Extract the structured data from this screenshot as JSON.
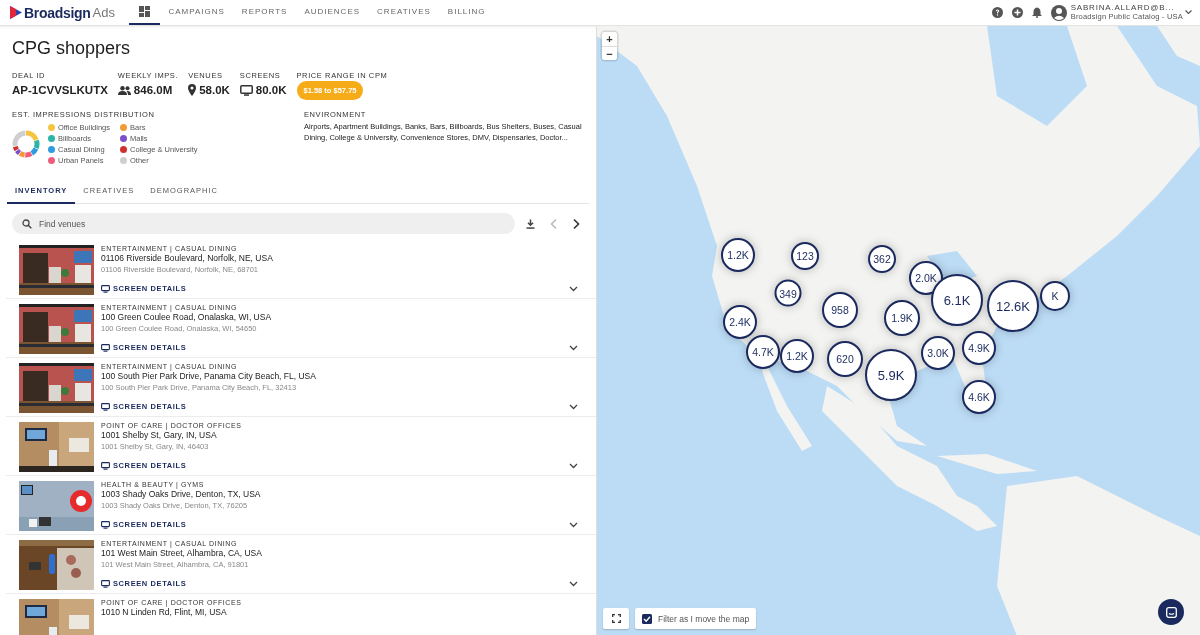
{
  "header": {
    "logo": {
      "brand": "Broadsign",
      "product": "Ads"
    },
    "nav": [
      {
        "kind": "icon",
        "selected": true
      },
      {
        "label": "CAMPAIGNS",
        "selected": false
      },
      {
        "label": "REPORTS",
        "selected": false
      },
      {
        "label": "AUDIENCES",
        "selected": false
      },
      {
        "label": "CREATIVES",
        "selected": false
      },
      {
        "label": "BILLING",
        "selected": false
      }
    ],
    "user": {
      "name": "SABRINA.ALLARD@B...",
      "account": "Broadsign Public Catalog - USA"
    }
  },
  "deal": {
    "title": "CPG shoppers",
    "stats": [
      {
        "kind": "text",
        "label": "DEAL ID",
        "value": "AP-1CVVSLKUTX"
      },
      {
        "kind": "people",
        "label": "WEEKLY IMPS.",
        "value": "846.0M"
      },
      {
        "kind": "pin",
        "label": "VENUES",
        "value": "58.0K"
      },
      {
        "kind": "screen",
        "label": "SCREENS",
        "value": "80.0K"
      },
      {
        "kind": "badge",
        "label": "PRICE RANGE IN CPM",
        "value": "$1.58 to $57.75"
      }
    ],
    "distribution": {
      "label": "EST. IMPRESSIONS DISTRIBUTION",
      "legend": [
        {
          "name": "Office Buildings",
          "color": "#f5c542"
        },
        {
          "name": "Billboards",
          "color": "#2bb5a6"
        },
        {
          "name": "Casual Dining",
          "color": "#2f9be0"
        },
        {
          "name": "Urban Panels",
          "color": "#ef5d7c"
        },
        {
          "name": "Bars",
          "color": "#f39a38"
        },
        {
          "name": "Malls",
          "color": "#7d4fc8"
        },
        {
          "name": "College & University",
          "color": "#d22f2f"
        },
        {
          "name": "Other",
          "color": "#cfcfcf"
        }
      ]
    },
    "environment": {
      "label": "ENVIRONMENT",
      "text": "Airports, Apartment Buildings, Banks, Bars, Billboards, Bus Shelters, Buses, Casual Dining, College & University, Convenience Stores, DMV, Dispensaries, Doctor..."
    }
  },
  "tabs": [
    {
      "label": "INVENTORY",
      "selected": true
    },
    {
      "label": "CREATIVES",
      "selected": false
    },
    {
      "label": "DEMOGRAPHIC",
      "selected": false
    }
  ],
  "search": {
    "placeholder": "Find venues"
  },
  "pager": {
    "previous_disabled": true,
    "next_disabled": false
  },
  "venues": [
    {
      "category": "ENTERTAINMENT | CASUAL DINING",
      "title": "01106 Riverside Boulevard, Norfolk, NE, USA",
      "address": "01106 Riverside Boulevard, Norfolk, NE, 68701",
      "link": "SCREEN DETAILS"
    },
    {
      "category": "ENTERTAINMENT | CASUAL DINING",
      "title": "100 Green Coulee Road, Onalaska, WI, USA",
      "address": "100 Green Coulee Road, Onalaska, WI, 54650",
      "link": "SCREEN DETAILS"
    },
    {
      "category": "ENTERTAINMENT | CASUAL DINING",
      "title": "100 South Pier Park Drive, Panama City Beach, FL, USA",
      "address": "100 South Pier Park Drive, Panama City Beach, FL, 32413",
      "link": "SCREEN DETAILS"
    },
    {
      "category": "POINT OF CARE | DOCTOR OFFICES",
      "title": "1001 Shelby St, Gary, IN, USA",
      "address": "1001 Shelby St, Gary, IN, 46403",
      "link": "SCREEN DETAILS"
    },
    {
      "category": "HEALTH & BEAUTY | GYMS",
      "title": "1003 Shady Oaks Drive, Denton, TX, USA",
      "address": "1003 Shady Oaks Drive, Denton, TX, 76205",
      "link": "SCREEN DETAILS"
    },
    {
      "category": "ENTERTAINMENT | CASUAL DINING",
      "title": "101 West Main Street, Alhambra, CA, USA",
      "address": "101 West Main Street, Alhambra, CA, 91801",
      "link": "SCREEN DETAILS"
    },
    {
      "category": "POINT OF CARE | DOCTOR OFFICES",
      "title": "1010 N Linden Rd, Flint, MI, USA"
    }
  ],
  "map": {
    "zoom_in": "+",
    "zoom_out": "−",
    "clusters": [
      "1.2K",
      "123",
      "362",
      "2.0K",
      "349",
      "958",
      "1.9K",
      "K",
      "6.1K",
      "12.6K",
      "2.4K",
      "4.7K",
      "1.2K",
      "620",
      "5.9K",
      "3.0K",
      "4.9K",
      "4.6K"
    ],
    "filter": {
      "label": "Filter as I move the map",
      "checked": true
    }
  }
}
